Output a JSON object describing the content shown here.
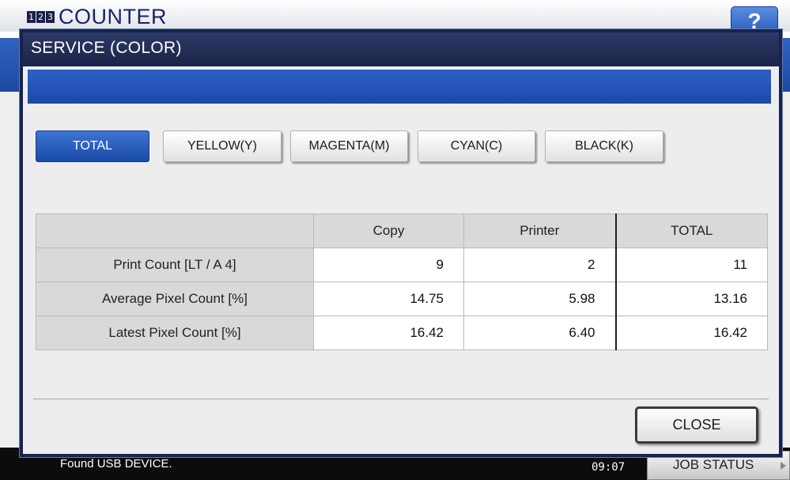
{
  "background": {
    "counter_badge": [
      "1",
      "2",
      "3"
    ],
    "screen_title": "COUNTER",
    "help_label": "?",
    "status_message": "Found USB DEVICE.",
    "clock": "09:07",
    "job_status_label": "JOB STATUS"
  },
  "dialog": {
    "title": "SERVICE (COLOR)",
    "tabs": [
      {
        "label": "TOTAL",
        "active": true
      },
      {
        "label": "YELLOW(Y)",
        "active": false
      },
      {
        "label": "MAGENTA(M)",
        "active": false
      },
      {
        "label": "CYAN(C)",
        "active": false
      },
      {
        "label": "BLACK(K)",
        "active": false
      }
    ],
    "table": {
      "headers": [
        "",
        "Copy",
        "Printer",
        "TOTAL"
      ],
      "rows": [
        {
          "label": "Print Count [LT / A 4]",
          "values": [
            "9",
            "2",
            "11"
          ]
        },
        {
          "label": "Average Pixel Count [%]",
          "values": [
            "14.75",
            "5.98",
            "13.16"
          ]
        },
        {
          "label": "Latest Pixel Count [%]",
          "values": [
            "16.42",
            "6.40",
            "16.42"
          ]
        }
      ]
    },
    "close_label": "CLOSE"
  },
  "colors": {
    "accent_blue": "#1b4aa6",
    "dialog_frame": "#142350"
  }
}
